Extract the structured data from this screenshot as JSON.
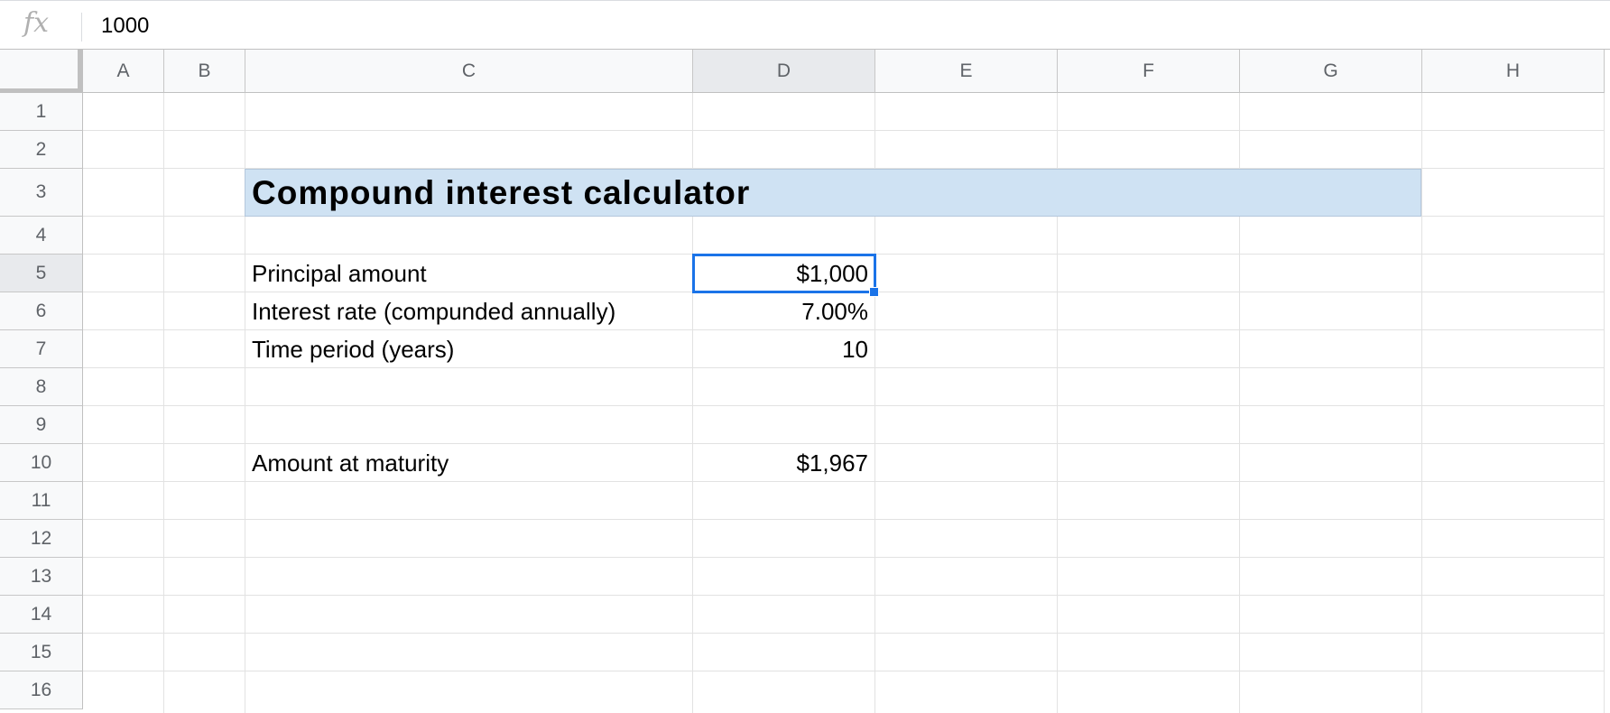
{
  "formula_bar": {
    "icon": "fx-icon",
    "icon_text": "fx",
    "value": "1000"
  },
  "columns": [
    "A",
    "B",
    "C",
    "D",
    "E",
    "F",
    "G",
    "H"
  ],
  "selected_column": "D",
  "rows": [
    "1",
    "2",
    "3",
    "4",
    "5",
    "6",
    "7",
    "8",
    "9",
    "10",
    "11",
    "12",
    "13",
    "14",
    "15",
    "16"
  ],
  "selected_row": "5",
  "sheet": {
    "title": "Compound interest calculator",
    "principal_label": "Principal amount",
    "principal_value": "$1,000",
    "rate_label": "Interest rate (compunded annually)",
    "rate_value": "7.00%",
    "period_label": "Time period (years)",
    "period_value": "10",
    "maturity_label": "Amount at maturity",
    "maturity_value": "$1,967"
  },
  "colors": {
    "selection": "#1a73e8",
    "title_fill": "#cfe2f3"
  }
}
